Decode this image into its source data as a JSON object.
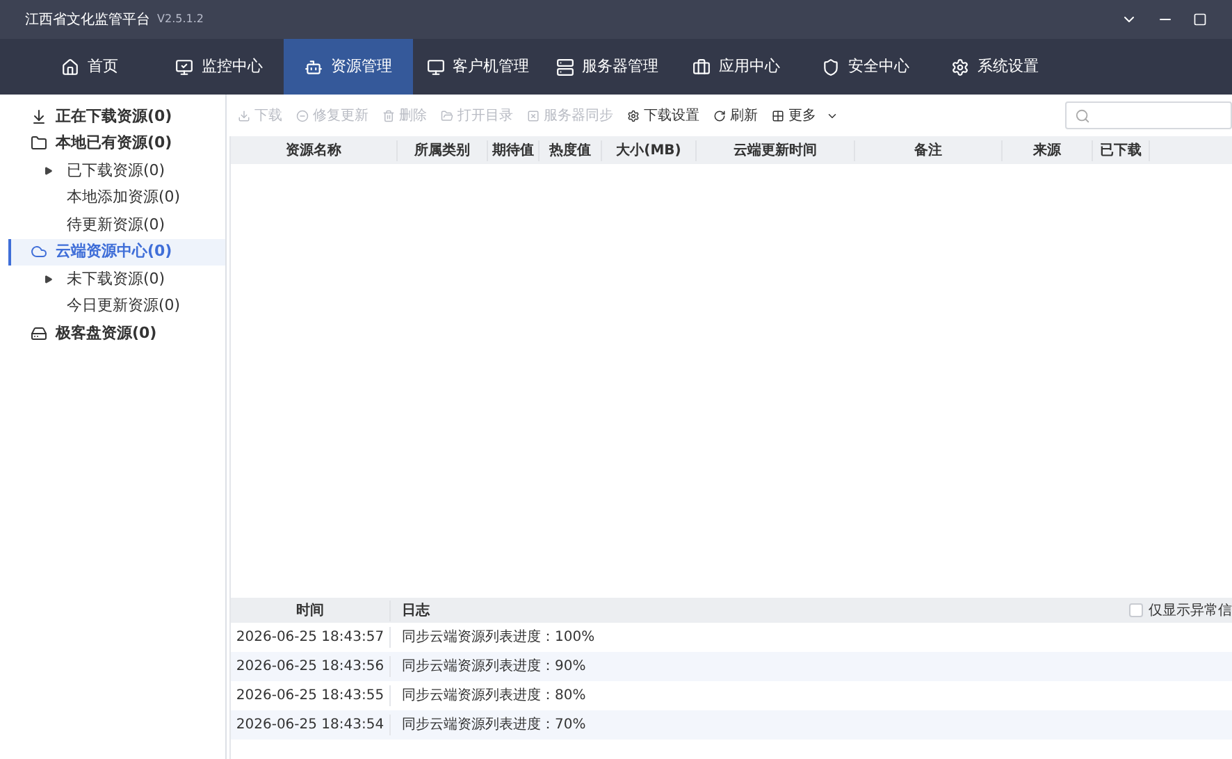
{
  "window": {
    "title": "江西省文化监管平台",
    "version": "V2.5.1.2"
  },
  "nav_tabs": [
    {
      "label": "首页",
      "selected": false
    },
    {
      "label": "监控中心",
      "selected": false
    },
    {
      "label": "资源管理",
      "selected": true
    },
    {
      "label": "客户机管理",
      "selected": false
    },
    {
      "label": "服务器管理",
      "selected": false
    },
    {
      "label": "应用中心",
      "selected": false
    },
    {
      "label": "安全中心",
      "selected": false
    },
    {
      "label": "系统设置",
      "selected": false
    }
  ],
  "sidebar": {
    "items": [
      {
        "label": "正在下载资源(0)",
        "selected": false
      },
      {
        "label": "本地已有资源(0)",
        "selected": false,
        "children": [
          {
            "label": "已下载资源(0)",
            "selected": false,
            "expandable": true
          },
          {
            "label": "本地添加资源(0)",
            "selected": false,
            "expandable": false
          },
          {
            "label": "待更新资源(0)",
            "selected": false,
            "expandable": false
          }
        ]
      },
      {
        "label": "云端资源中心(0)",
        "selected": true,
        "children": [
          {
            "label": "未下载资源(0)",
            "selected": false,
            "expandable": true
          },
          {
            "label": "今日更新资源(0)",
            "selected": false,
            "expandable": false
          }
        ]
      },
      {
        "label": "极客盘资源(0)",
        "selected": false
      }
    ]
  },
  "toolbar": [
    {
      "label": "下载",
      "disabled": true
    },
    {
      "label": "修复更新",
      "disabled": true
    },
    {
      "label": "删除",
      "disabled": true
    },
    {
      "label": "打开目录",
      "disabled": true
    },
    {
      "label": "服务器同步",
      "disabled": true
    },
    {
      "label": "下载设置",
      "disabled": false
    },
    {
      "label": "刷新",
      "disabled": false
    },
    {
      "label": "更多",
      "disabled": false,
      "dropdown": true
    }
  ],
  "table": {
    "columns": [
      "资源名称",
      "所属类别",
      "期待值",
      "热度值",
      "大小(MB)",
      "云端更新时间",
      "备注",
      "来源",
      "已下载"
    ]
  },
  "log": {
    "columns": [
      "时间",
      "日志"
    ],
    "filter": {
      "label": "仅显示异常信",
      "checked": false
    },
    "rows": [
      [
        "2026-06-25 18:43:57",
        "同步云端资源列表进度：100%"
      ],
      [
        "2026-06-25 18:43:56",
        "同步云端资源列表进度：90%"
      ],
      [
        "2026-06-25 18:43:55",
        "同步云端资源列表进度：80%"
      ],
      [
        "2026-06-25 18:43:54",
        "同步云端资源列表进度：70%"
      ]
    ]
  }
}
